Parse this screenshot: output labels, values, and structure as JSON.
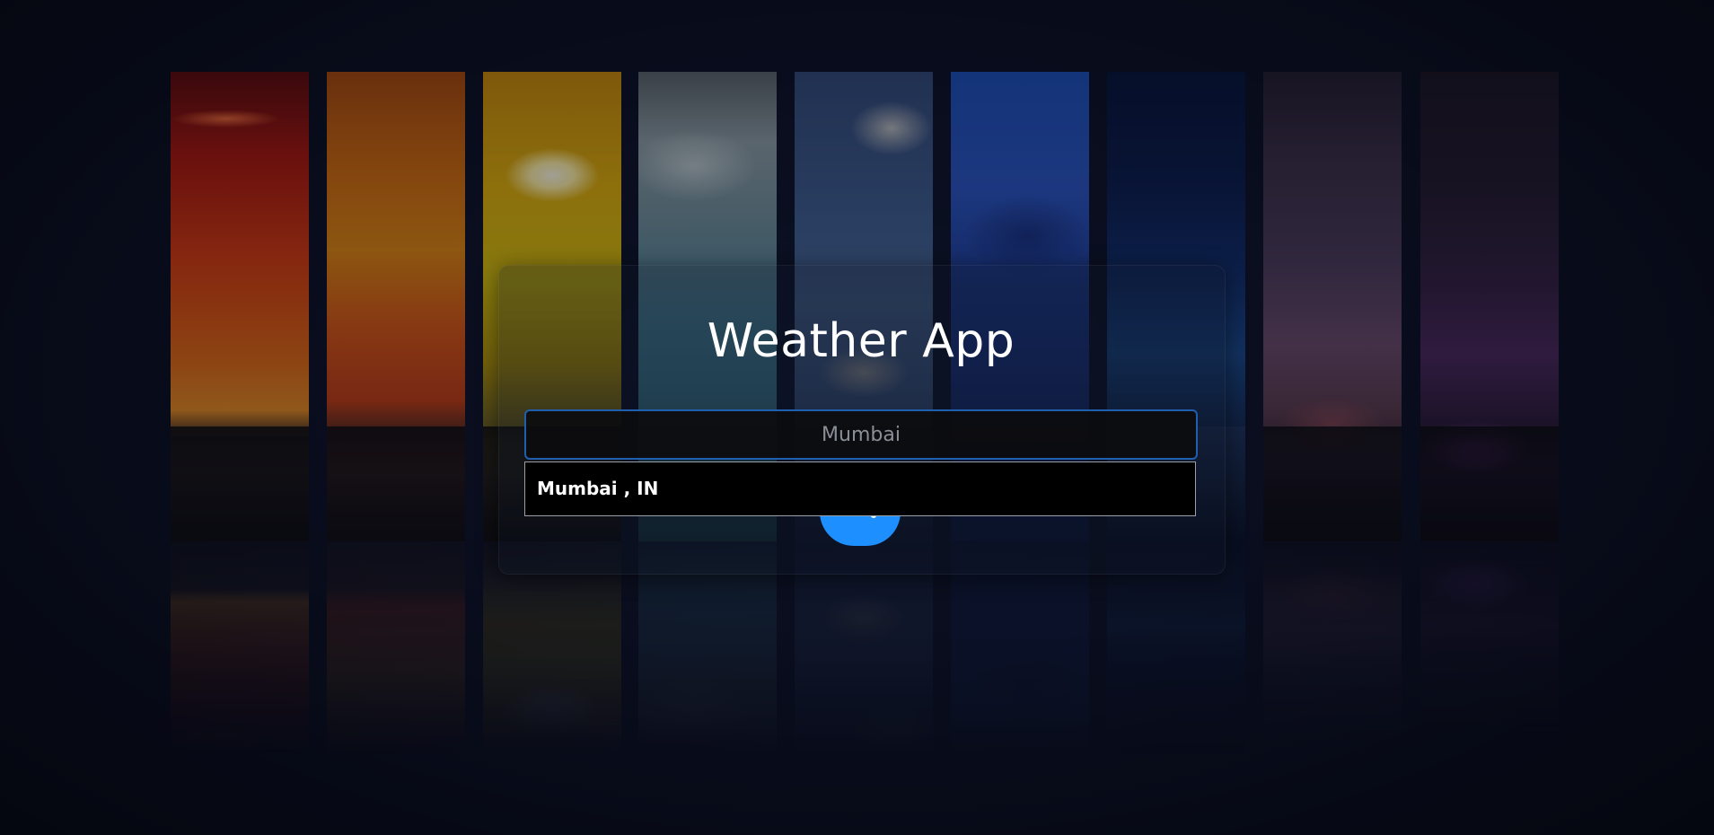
{
  "app": {
    "title": "Weather App"
  },
  "search": {
    "value": "Mumbai",
    "placeholder": "",
    "button_icon": "search-icon"
  },
  "suggestions": [
    {
      "label": "Mumbai , IN"
    }
  ],
  "colors": {
    "accent": "#1e8fff",
    "input_border": "#1f5fae",
    "page_background": "#0a0d18"
  }
}
